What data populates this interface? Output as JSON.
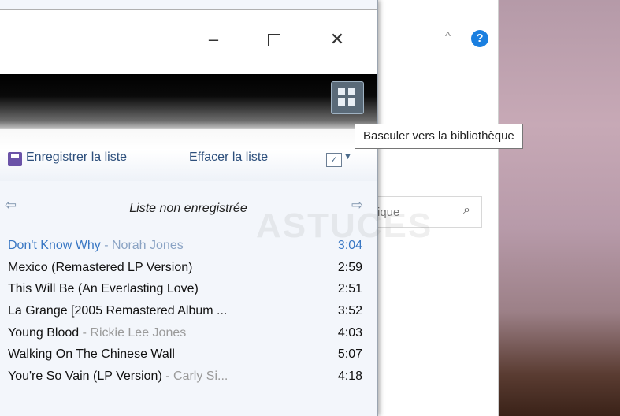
{
  "explorer": {
    "search_placeholder": "ique"
  },
  "player": {
    "switch_tooltip": "Basculer vers la bibliothèque",
    "toolbar": {
      "save_label": "Enregistrer la liste",
      "clear_label": "Effacer la liste"
    },
    "list_title": "Liste non enregistrée",
    "watermark": "ASTUCES",
    "tracks": [
      {
        "title": "Don't Know Why",
        "artist": "- Norah Jones",
        "duration": "3:04",
        "active": true
      },
      {
        "title": "Mexico (Remastered LP Version)",
        "artist": "",
        "duration": "2:59"
      },
      {
        "title": "This Will Be (An Everlasting Love)",
        "artist": "",
        "duration": "2:51"
      },
      {
        "title": "La Grange [2005 Remastered Album ...",
        "artist": "",
        "duration": "3:52"
      },
      {
        "title": "Young Blood",
        "artist": "- Rickie Lee Jones",
        "duration": "4:03"
      },
      {
        "title": "Walking On The Chinese Wall",
        "artist": "",
        "duration": "5:07"
      },
      {
        "title": "You're So Vain (LP Version)",
        "artist": "- Carly Si...",
        "duration": "4:18"
      }
    ]
  },
  "icons": {
    "help": "?",
    "collapse": "^"
  },
  "colors": {
    "active_track": "#3a78c4",
    "help_blue": "#1a7fe0"
  }
}
